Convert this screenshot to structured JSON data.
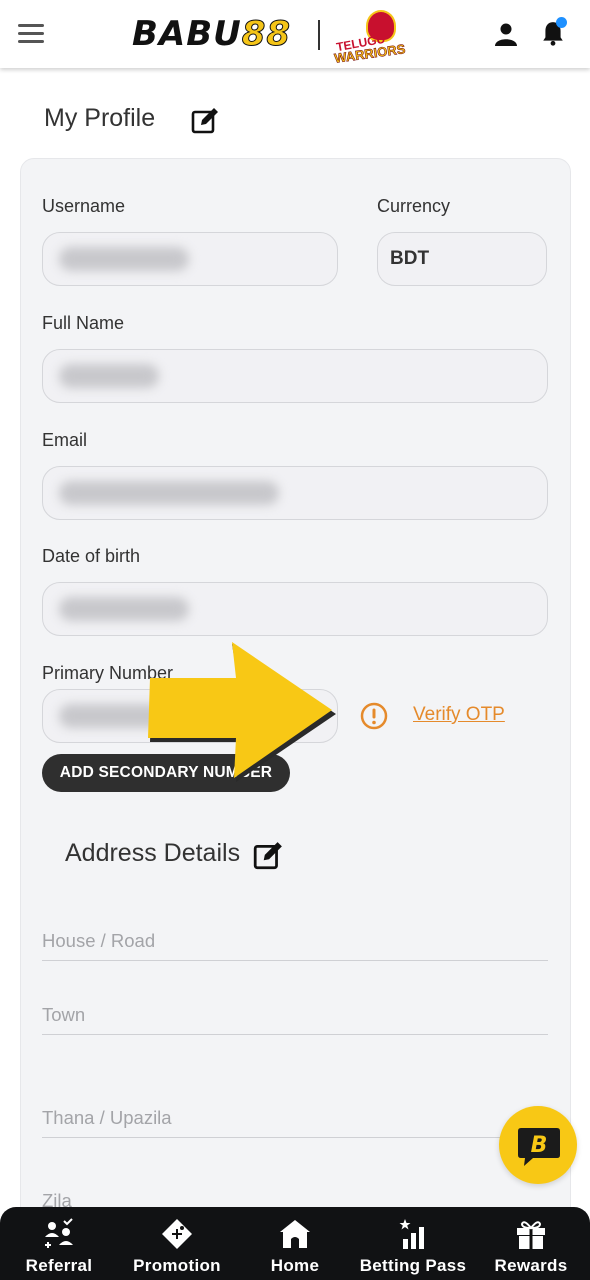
{
  "header": {
    "logo_part1": "BABU",
    "logo_part2": "88",
    "badge_line1": "TELUGU",
    "badge_line2": "WARRIORS"
  },
  "profile": {
    "title": "My Profile",
    "fields": {
      "username_label": "Username",
      "currency_label": "Currency",
      "currency_value": "BDT",
      "fullname_label": "Full Name",
      "email_label": "Email",
      "dob_label": "Date of birth",
      "primary_label": "Primary Number"
    },
    "verify_otp": "Verify OTP",
    "add_secondary": "ADD SECONDARY NUMBER"
  },
  "address": {
    "title": "Address Details",
    "fields": [
      "House / Road",
      "Town",
      "Thana / Upazila",
      "Zila"
    ]
  },
  "nav": {
    "items": [
      {
        "label": "Referral",
        "icon": "referral-icon"
      },
      {
        "label": "Promotion",
        "icon": "promotion-icon"
      },
      {
        "label": "Home",
        "icon": "home-icon"
      },
      {
        "label": "Betting Pass",
        "icon": "betting-pass-icon"
      },
      {
        "label": "Rewards",
        "icon": "rewards-icon"
      }
    ]
  },
  "colors": {
    "accent": "#f8c815",
    "verify": "#e58a2b",
    "nav_bg": "#111214"
  }
}
